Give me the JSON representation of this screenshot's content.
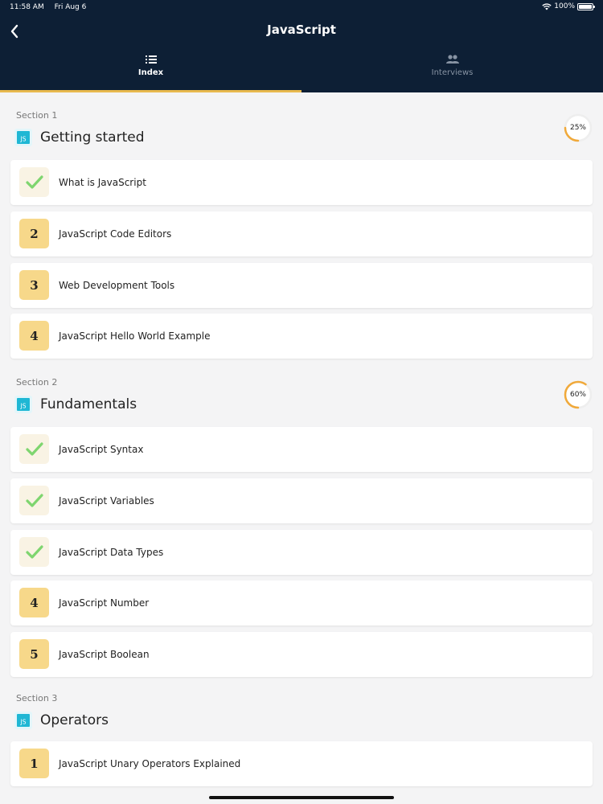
{
  "status_bar": {
    "time": "11:58 AM",
    "date": "Fri Aug 6",
    "battery": "100%",
    "battery_level": 1.0
  },
  "nav": {
    "back_icon": "chevron-left-icon",
    "title": "JavaScript"
  },
  "tabs": [
    {
      "label": "Index",
      "icon": "list-icon",
      "active": true
    },
    {
      "label": "Interviews",
      "icon": "people-icon",
      "active": false
    }
  ],
  "colors": {
    "header_bg": "#0d1f35",
    "accent": "#e8b94e",
    "badge_bg": "#f7d88a",
    "check_green": "#7ed56f",
    "js_icon": "#1fb7d4"
  },
  "sections": [
    {
      "label": "Section 1",
      "title": "Getting started",
      "icon": "js-icon",
      "progress_text": "25%",
      "progress": 0.25,
      "lessons": [
        {
          "badge": "",
          "completed": true,
          "title": "What is JavaScript"
        },
        {
          "badge": "2",
          "completed": false,
          "title": "JavaScript Code Editors"
        },
        {
          "badge": "3",
          "completed": false,
          "title": "Web Development Tools"
        },
        {
          "badge": "4",
          "completed": false,
          "title": "JavaScript Hello World Example"
        }
      ]
    },
    {
      "label": "Section 2",
      "title": "Fundamentals",
      "icon": "js-icon",
      "progress_text": "60%",
      "progress": 0.6,
      "lessons": [
        {
          "badge": "",
          "completed": true,
          "title": "JavaScript Syntax"
        },
        {
          "badge": "",
          "completed": true,
          "title": "JavaScript Variables"
        },
        {
          "badge": "",
          "completed": true,
          "title": "JavaScript Data Types"
        },
        {
          "badge": "4",
          "completed": false,
          "title": "JavaScript Number"
        },
        {
          "badge": "5",
          "completed": false,
          "title": "JavaScript Boolean"
        }
      ]
    },
    {
      "label": "Section 3",
      "title": "Operators",
      "icon": "js-icon",
      "lessons": [
        {
          "badge": "1",
          "completed": false,
          "title": "JavaScript Unary Operators Explained"
        }
      ]
    }
  ]
}
